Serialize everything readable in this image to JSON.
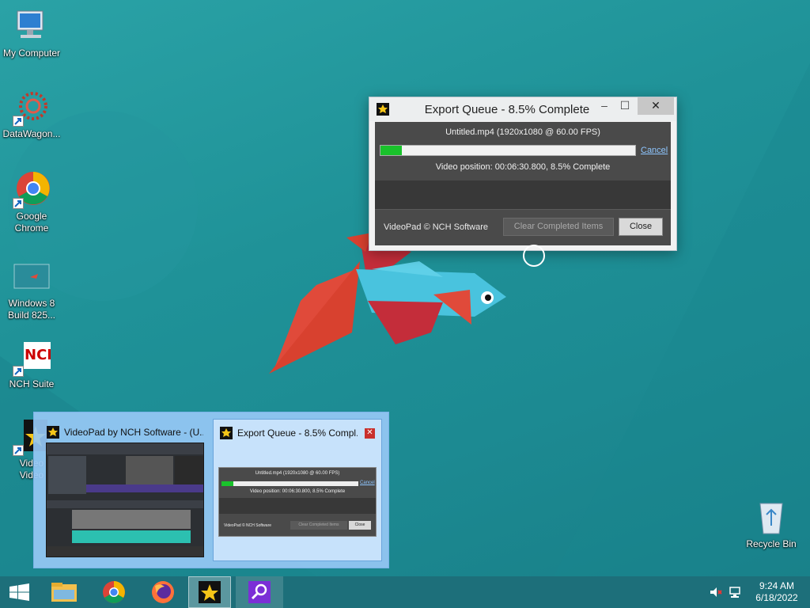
{
  "desktop": {
    "icons": [
      {
        "label": "My Computer"
      },
      {
        "label": "DataWagon..."
      },
      {
        "label": "Google\nChrome"
      },
      {
        "label": "Windows 8\nBuild 825..."
      },
      {
        "label": "NCH Suite"
      },
      {
        "label": "Video\nVideo"
      },
      {
        "label": "Recycle Bin"
      }
    ]
  },
  "export_window": {
    "title": "Export Queue - 8.5% Complete",
    "file_line": "Untitled.mp4 (1920x1080 @ 60.00 FPS)",
    "progress_fraction": 0.085,
    "cancel_label": "Cancel",
    "position_line": "Video position:  00:06:30.800, 8.5% Complete",
    "brand": "VideoPad © NCH Software",
    "clear_button": "Clear Completed Items",
    "close_button": "Close",
    "controls": {
      "minimize": "–",
      "maximize": "☐",
      "close": "✕"
    }
  },
  "thumbnail_popup": {
    "items": [
      {
        "title": "VideoPad by NCH Software - (U..."
      },
      {
        "title": "Export Queue - 8.5% Compl...",
        "close": "✕"
      }
    ],
    "mini": {
      "file_line": "Untitled.mp4 (1920x1080 @ 60.00 FPS)",
      "cancel_label": "Cancel",
      "position_line": "Video position:  00:06:30.800, 8.5% Complete",
      "brand": "VideoPad © NCH Software",
      "clear_button": "Clear Completed Items",
      "close_button": "Close"
    }
  },
  "taskbar": {
    "buttons": [
      "start-button",
      "file-explorer",
      "google-chrome",
      "firefox",
      "videopad",
      "search-app"
    ],
    "clock": {
      "time": "9:24 AM",
      "date": "6/18/2022"
    }
  },
  "colors": {
    "accent_teal": "#1e8e96",
    "progress_green": "#19c22b",
    "window_dark": "#4a4a4a",
    "popup_blue": "#96c8f5"
  }
}
